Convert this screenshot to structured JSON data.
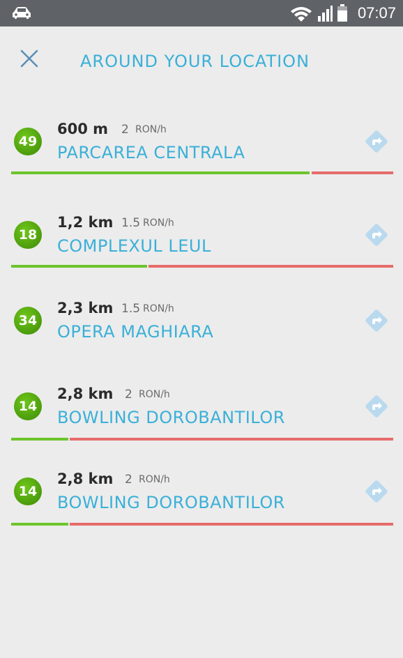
{
  "status_bar": {
    "time": "07:07",
    "icons": [
      "car-icon",
      "wifi-icon",
      "signal-icon",
      "battery-icon"
    ]
  },
  "header": {
    "title": "AROUND YOUR LOCATION",
    "close_icon": "close-icon"
  },
  "colors": {
    "accent": "#3ab0d8",
    "badge_green": "#4fa30f",
    "bar_free": "#6cc52c",
    "bar_occupied": "#e66b6b"
  },
  "parkings": [
    {
      "spots": "49",
      "distance": "600 m",
      "price": "2",
      "unit": "RON/h",
      "name": "PARCAREA CENTRALA",
      "free_fraction": 0.78,
      "has_bar": true
    },
    {
      "spots": "18",
      "distance": "1,2 km",
      "price": "1.5",
      "unit": "RON/h",
      "name": "COMPLEXUL LEUL",
      "free_fraction": 0.36,
      "has_bar": true
    },
    {
      "spots": "34",
      "distance": "2,3 km",
      "price": "1.5",
      "unit": "RON/h",
      "name": "OPERA MAGHIARA",
      "free_fraction": null,
      "has_bar": false
    },
    {
      "spots": "14",
      "distance": "2,8 km",
      "price": "2",
      "unit": "RON/h",
      "name": "BOWLING DOROBANTILOR",
      "free_fraction": 0.15,
      "has_bar": true
    },
    {
      "spots": "14",
      "distance": "2,8 km",
      "price": "2",
      "unit": "RON/h",
      "name": "BOWLING DOROBANTILOR",
      "free_fraction": 0.15,
      "has_bar": true
    }
  ]
}
